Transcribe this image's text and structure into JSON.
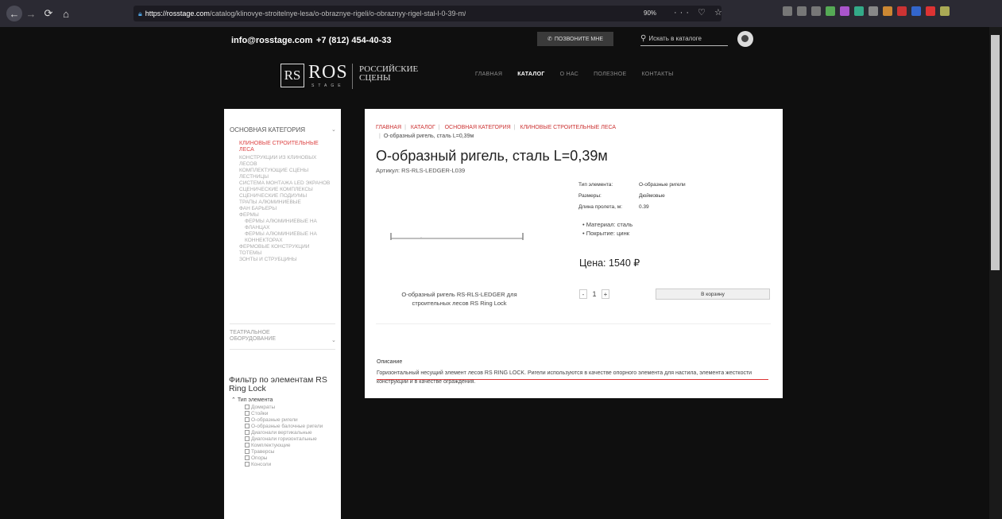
{
  "browser": {
    "url_domain": "https://rosstage.com",
    "url_path": "/catalog/klinovye-stroitelnye-lesa/o-obraznye-rigeli/o-obraznyy-rigel-stal-l-0-39-m/",
    "zoom": "90%",
    "actions": "··· ♡ ☆"
  },
  "header": {
    "email": "info@rosstage.com",
    "phone": "+7 (812) 454-40-33",
    "callback_label": "ПОЗВОНИТЕ МНЕ",
    "search_placeholder": "Искать в каталоге"
  },
  "logo": {
    "rs": "RS",
    "ros": "ROS",
    "stage": "STAGE",
    "tagline": "РОССИЙСКИЕ СЦЕНЫ"
  },
  "nav": [
    "ГЛАВНАЯ",
    "КАТАЛОГ",
    "О НАС",
    "ПОЛЕЗНОЕ",
    "КОНТАКТЫ"
  ],
  "sidebar": {
    "section_title": "ОСНОВНАЯ КАТЕГОРИЯ",
    "active_item": "КЛИНОВЫЕ СТРОИТЕЛЬНЫЕ ЛЕСА",
    "items": [
      "КОНСТРУКЦИИ ИЗ КЛИНОВЫХ ЛЕСОВ",
      "КОМПЛЕКТУЮЩИЕ СЦЕНЫ",
      "ЛЕСТНИЦЫ",
      "СИСТЕМА МОНТАЖА LED ЭКРАНОВ",
      "СЦЕНИЧЕСКИЕ КОМПЛЕКСЫ",
      "СЦЕНИЧЕСКИЕ ПОДИУМЫ",
      "ТРАПЫ АЛЮМИНИЕВЫЕ",
      "ФАН БАРЬЕРЫ",
      "ФЕРМЫ",
      "ФЕРМЫ АЛЮМИНИЕВЫЕ НА ФЛАНЦАХ",
      "ФЕРМЫ АЛЮМИНИЕВЫЕ НА КОННЕКТОРАХ",
      "ФЕРМОВЫЕ КОНСТРУКЦИИ",
      "ТОТЕМЫ",
      "ЗОНТЫ И СТРУБЦИНЫ"
    ],
    "theatre": "ТЕАТРАЛЬНОЕ ОБОРУДОВАНИЕ",
    "filter_title": "Фильтр по элементам RS Ring Lock",
    "filter_group": "Тип элемента",
    "filter_items": [
      "Домкраты",
      "Стойки",
      "О-образные ригели",
      "О-образные балочные ригели",
      "Диагонали вертикальные",
      "Диагонали горизонтальные",
      "Комплектующие",
      "Траверсы",
      "Опоры",
      "Консоли"
    ]
  },
  "product": {
    "breadcrumb": [
      "ГЛАВНАЯ",
      "КАТАЛОГ",
      "ОСНОВНАЯ КАТЕГОРИЯ",
      "КЛИНОВЫЕ СТРОИТЕЛЬНЫЕ ЛЕСА"
    ],
    "breadcrumb_current": "О-образный ригель, сталь L=0,39м",
    "title": "О-образный ригель, сталь L=0,39м",
    "article": "Артикул: RS-RLS-LEDGER-L039",
    "specs": [
      {
        "label": "Тип элемента:",
        "value": "О-образные ригели"
      },
      {
        "label": "Размеры:",
        "value": "Дюймовые"
      },
      {
        "label": "Длина пролета, м:",
        "value": "0.39"
      }
    ],
    "bullets": [
      "Материал: сталь",
      "Покрытие: цинк"
    ],
    "price": "Цена: 1540 ₽",
    "caption": "О-образный ригель RS-RLS-LEDGER для строительных лесов RS Ring Lock",
    "qty": "1",
    "cart_label": "В корзину",
    "desc_label": "Описание",
    "description": "Горизонтальный несущий элемент лесов RS RING LOCK. Ригели используются в качестве опорного элемента для настила, элемента жесткости конструкции и в качестве ограждения."
  }
}
